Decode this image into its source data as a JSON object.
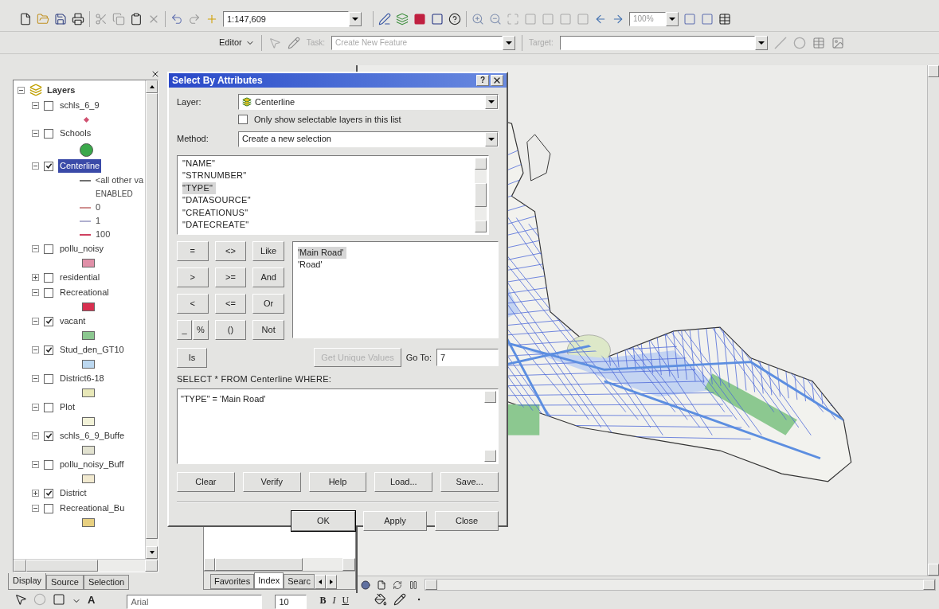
{
  "toolbar": {
    "scale": "1:147,609",
    "zoom": "100%"
  },
  "editor_toolbar": {
    "editor": "Editor",
    "task_label": "Task:",
    "task_value": "Create New Feature",
    "target_label": "Target:"
  },
  "toc": {
    "root": "Layers",
    "layers": [
      {
        "name": "schls_6_9",
        "checked": false,
        "expanded": true,
        "selected": false,
        "legend": [
          {
            "kind": "marker",
            "color": "#d05070"
          }
        ]
      },
      {
        "name": "Schools",
        "checked": false,
        "expanded": true,
        "selected": false,
        "legend": [
          {
            "kind": "circle",
            "color": "#3aa84a"
          }
        ]
      },
      {
        "name": "Centerline",
        "checked": true,
        "expanded": true,
        "selected": true,
        "legend": [
          {
            "kind": "line",
            "color": "#707070",
            "label": "<all other va"
          },
          {
            "kind": "text",
            "label": "ENABLED"
          },
          {
            "kind": "line",
            "color": "#d09090",
            "label": "0"
          },
          {
            "kind": "line",
            "color": "#b0b0d0",
            "label": "1"
          },
          {
            "kind": "line",
            "color": "#d04060",
            "label": "100"
          }
        ]
      },
      {
        "name": "pollu_noisy",
        "checked": false,
        "expanded": true,
        "selected": false,
        "legend": [
          {
            "kind": "swatch",
            "color": "#e090a8"
          }
        ]
      },
      {
        "name": "residential",
        "checked": false,
        "expanded": false,
        "selected": false
      },
      {
        "name": "Recreational",
        "checked": false,
        "expanded": true,
        "selected": false,
        "legend": [
          {
            "kind": "swatch",
            "color": "#d83050"
          }
        ]
      },
      {
        "name": "vacant",
        "checked": true,
        "expanded": true,
        "selected": false,
        "legend": [
          {
            "kind": "swatch",
            "color": "#8cc890"
          }
        ]
      },
      {
        "name": "Stud_den_GT10",
        "checked": true,
        "expanded": true,
        "selected": false,
        "legend": [
          {
            "kind": "swatch",
            "color": "#bcd8f0"
          }
        ]
      },
      {
        "name": "District6-18",
        "checked": false,
        "expanded": true,
        "selected": false,
        "legend": [
          {
            "kind": "swatch",
            "color": "#e8e8b8"
          }
        ]
      },
      {
        "name": "Plot",
        "checked": false,
        "expanded": true,
        "selected": false,
        "legend": [
          {
            "kind": "swatch",
            "color": "#f2f2d8"
          }
        ]
      },
      {
        "name": "schls_6_9_Buffe",
        "checked": true,
        "expanded": true,
        "selected": false,
        "legend": [
          {
            "kind": "swatch",
            "color": "#e2e2d0"
          }
        ]
      },
      {
        "name": "pollu_noisy_Buff",
        "checked": false,
        "expanded": true,
        "selected": false,
        "legend": [
          {
            "kind": "swatch",
            "color": "#f2ead0"
          }
        ]
      },
      {
        "name": "District",
        "checked": true,
        "expanded": false,
        "selected": false
      },
      {
        "name": "Recreational_Bu",
        "checked": false,
        "expanded": true,
        "selected": false,
        "legend": [
          {
            "kind": "swatch",
            "color": "#e8d080"
          }
        ]
      }
    ],
    "tabs": [
      {
        "label": "Display",
        "selected": true
      },
      {
        "label": "Source",
        "selected": false
      },
      {
        "label": "Selection",
        "selected": false
      }
    ]
  },
  "catalog": {
    "tabs": [
      {
        "label": "Favorites",
        "selected": false
      },
      {
        "label": "Index",
        "selected": true
      },
      {
        "label": "Searc",
        "selected": false
      }
    ]
  },
  "dialog": {
    "title": "Select By Attributes",
    "help": "?",
    "layer_label": "Layer:",
    "layer_value": "Centerline",
    "only_selectable": {
      "label": "Only show selectable layers in this list",
      "checked": false
    },
    "method_label": "Method:",
    "method_value": "Create a new selection",
    "fields": [
      {
        "label": "\"NAME\"",
        "selected": false
      },
      {
        "label": "\"STRNUMBER\"",
        "selected": false
      },
      {
        "label": "\"TYPE\"",
        "selected": true
      },
      {
        "label": "\"DATASOURCE\"",
        "selected": false
      },
      {
        "label": "\"CREATIONUS\"",
        "selected": false
      },
      {
        "label": "\"DATECREATE\"",
        "selected": false
      }
    ],
    "operators": [
      "=",
      "<>",
      "Like",
      ">",
      ">=",
      "And",
      "<",
      "<=",
      "Or",
      "_",
      "%",
      "()",
      "Not",
      "Is"
    ],
    "values": [
      {
        "label": "'Main Road'",
        "selected": true
      },
      {
        "label": "'Road'",
        "selected": false
      }
    ],
    "get_unique": {
      "label": "Get Unique Values",
      "disabled": true
    },
    "goto_label": "Go To:",
    "goto_value": "7",
    "sql_label": "SELECT * FROM Centerline WHERE:",
    "expression": "\"TYPE\" = 'Main Road'",
    "tool_buttons": [
      "Clear",
      "Verify",
      "Help",
      "Load...",
      "Save..."
    ],
    "buttons": [
      {
        "label": "OK",
        "default": true
      },
      {
        "label": "Apply",
        "default": false
      },
      {
        "label": "Close",
        "default": false
      }
    ]
  },
  "draw_toolbar": {
    "font": "Arial",
    "size": "10",
    "bold": "B",
    "italic": "I",
    "underline": "U",
    "font_color": "A"
  }
}
